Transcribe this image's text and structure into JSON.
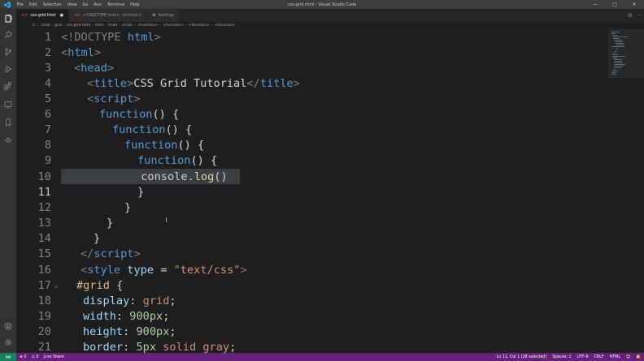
{
  "window": {
    "title": "css-grid.html - Visual Studio Code",
    "menu": [
      "File",
      "Edit",
      "Selection",
      "View",
      "Go",
      "Run",
      "Terminal",
      "Help"
    ],
    "controls": [
      "—",
      "□",
      "✕"
    ]
  },
  "tabs": [
    {
      "icon": "<>",
      "label": "css-grid.html",
      "sub": "",
      "suffix": "●",
      "active": true
    },
    {
      "icon": "<>",
      "label": "<!DOCTYPE html>",
      "sub": "Untitled-1",
      "suffix": "",
      "active": false
    },
    {
      "icon": "⚙",
      "label": "Settings",
      "sub": "",
      "suffix": "",
      "active": false
    }
  ],
  "breadcrumb": [
    "C:",
    "code",
    "grid",
    "css-grid.html",
    "html",
    "head",
    "script",
    "<function>",
    "<function>",
    "<function>",
    "<function>"
  ],
  "editor": {
    "current_line": 11,
    "lines": [
      {
        "n": "1"
      },
      {
        "n": "2"
      },
      {
        "n": "3"
      },
      {
        "n": "4"
      },
      {
        "n": "5"
      },
      {
        "n": "6"
      },
      {
        "n": "7"
      },
      {
        "n": "8"
      },
      {
        "n": "9"
      },
      {
        "n": "10"
      },
      {
        "n": "11"
      },
      {
        "n": "12"
      },
      {
        "n": "13"
      },
      {
        "n": "14"
      },
      {
        "n": "15"
      },
      {
        "n": "16"
      },
      {
        "n": "17"
      },
      {
        "n": "18"
      },
      {
        "n": "19"
      },
      {
        "n": "20"
      },
      {
        "n": "21"
      }
    ],
    "code": {
      "l1": [
        "<!DOCTYPE",
        "html",
        ">"
      ],
      "l2": [
        "<",
        "html",
        ">"
      ],
      "l3": [
        "<",
        "head",
        ">"
      ],
      "l4": [
        "<",
        "title",
        ">",
        "CSS Grid Tutorial",
        "</",
        "title",
        ">"
      ],
      "l5": [
        "<",
        "script",
        ">"
      ],
      "l6": [
        "function",
        "() {"
      ],
      "l7": [
        "function",
        "() {"
      ],
      "l8": [
        "function",
        "() {"
      ],
      "l9": [
        "function",
        "() {"
      ],
      "l10": [
        "············",
        "console",
        ".",
        "log",
        "()"
      ],
      "l11": [
        "}"
      ],
      "l12": [
        "}"
      ],
      "l13": [
        "}"
      ],
      "l14": [
        "}"
      ],
      "l15": [
        "</",
        "script",
        ">"
      ],
      "l16": [
        "<",
        "style",
        "type",
        " = ",
        "\"text/css\"",
        ">"
      ],
      "l17": [
        "#grid",
        " {"
      ],
      "l18": [
        "display",
        ": ",
        "grid",
        ";"
      ],
      "l19": [
        "width",
        ": ",
        "900px",
        ";"
      ],
      "l20": [
        "height",
        ": ",
        "900px",
        ";"
      ],
      "l21": [
        "border",
        ": ",
        "5px",
        " solid gray",
        ";"
      ]
    },
    "fold_marker": "⌄"
  },
  "statusbar": {
    "remote": "⋈",
    "errors": "⊗ 0",
    "warnings": "⚠ 0",
    "live_share": "Live Share",
    "position": "Ln 11, Col 1 (28 selected)",
    "spaces": "Spaces: 2",
    "encoding": "UTF-8",
    "eol": "CRLF",
    "language": "HTML",
    "feedback": "☺",
    "bell": "🔔"
  },
  "colors": {
    "titlebar": "#3c3c3c",
    "activity": "#333333",
    "editor_bg": "#1e1e1e",
    "statusbar": "#68217a",
    "remote": "#16825d"
  }
}
